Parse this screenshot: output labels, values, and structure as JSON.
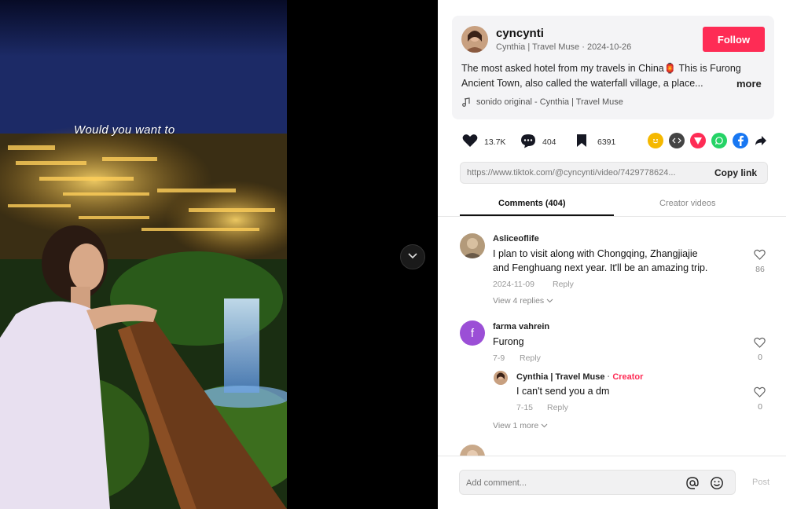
{
  "video": {
    "caption": "Would you want to"
  },
  "author": {
    "username": "cyncynti",
    "display_line": "Cynthia | Travel Muse · 2024-10-26",
    "follow_label": "Follow"
  },
  "description": {
    "line1": "The most asked hotel from my travels in China🏮 This is Furong",
    "line2": "Ancient Town, also called the waterfall village, a place...",
    "more_label": "more",
    "music": "sonido original - Cynthia | Travel Muse"
  },
  "actions": {
    "likes": "13.7K",
    "comments": "404",
    "saves": "6391"
  },
  "share_icons": [
    {
      "name": "friends-share-icon",
      "color": "#f5b800"
    },
    {
      "name": "embed-icon",
      "color": "#444444"
    },
    {
      "name": "send-icon",
      "color": "#fe2c55"
    },
    {
      "name": "whatsapp-icon",
      "color": "#25d366"
    },
    {
      "name": "facebook-icon",
      "color": "#1877f2"
    }
  ],
  "link": {
    "url": "https://www.tiktok.com/@cyncynti/video/7429778624...",
    "copy_label": "Copy link"
  },
  "tabs": {
    "comments": "Comments (404)",
    "creator_videos": "Creator videos"
  },
  "comments": [
    {
      "name": "Asliceoflife",
      "text_line1": "I plan to visit along with Chongqing, Zhangjiajie",
      "text_line2": "and Fenghuang next year. It'll be an amazing trip.",
      "date": "2024-11-09",
      "reply": "Reply",
      "likes": "86",
      "view_replies": "View 4 replies"
    },
    {
      "name": "farma vahrein",
      "avatar_letter": "f",
      "text": "Furong",
      "date": "7-9",
      "reply": "Reply",
      "likes": "0",
      "sub": {
        "name": "Cynthia | Travel Muse",
        "creator_label": "Creator",
        "text": "I can't send you a dm",
        "date": "7-15",
        "reply": "Reply",
        "likes": "0"
      },
      "view_more": "View 1 more"
    }
  ],
  "input": {
    "placeholder": "Add comment...",
    "post_label": "Post"
  }
}
